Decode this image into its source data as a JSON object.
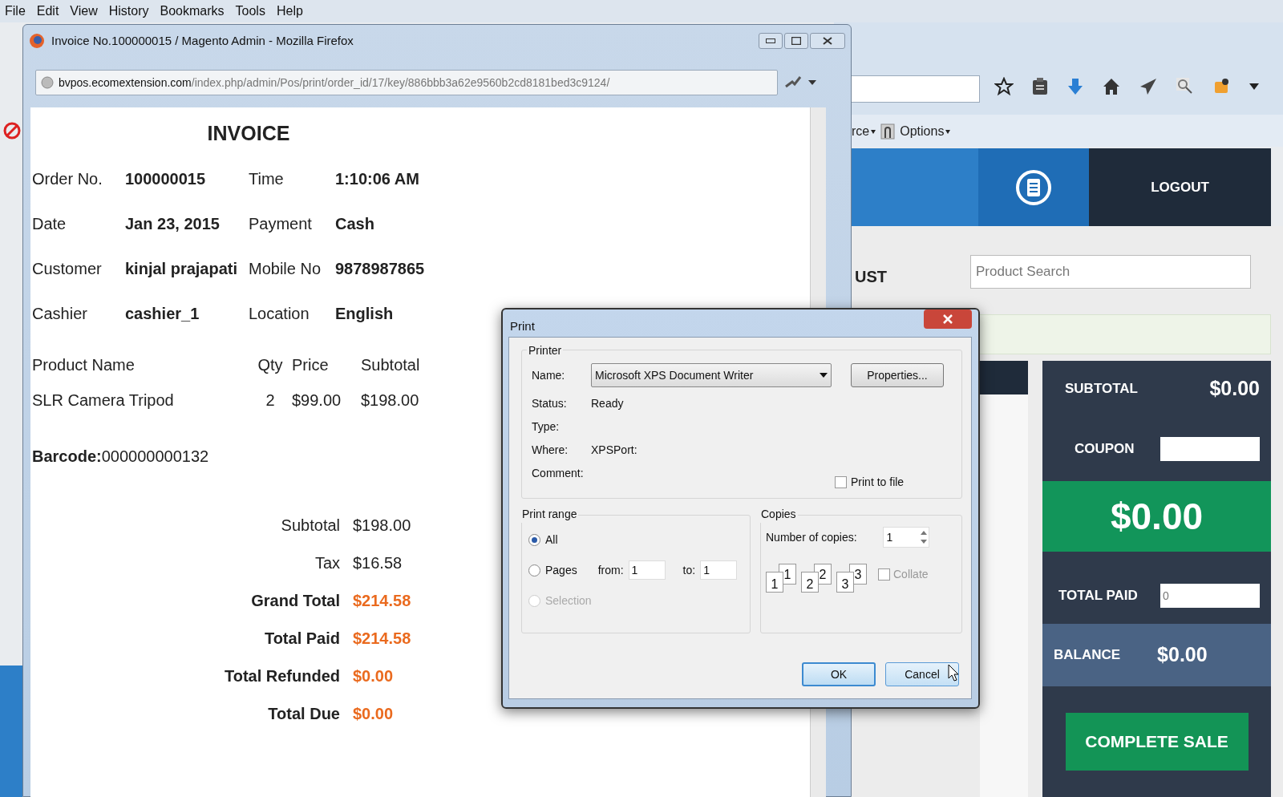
{
  "menu_bar": [
    {
      "label": "File"
    },
    {
      "label": "Edit"
    },
    {
      "label": "View"
    },
    {
      "label": "History"
    },
    {
      "label": "Bookmarks"
    },
    {
      "label": "Tools"
    },
    {
      "label": "Help"
    }
  ],
  "background_browser": {
    "bookmarks": [
      {
        "label": "rce"
      },
      {
        "label": "Options"
      }
    ]
  },
  "pos": {
    "logout": "LOGOUT",
    "list_heading": "UST",
    "search_placeholder": "Product Search",
    "summary": {
      "subtotal_label": "SUBTOTAL",
      "subtotal": "$0.00",
      "coupon_label": "COUPON",
      "total": "$0.00",
      "total_paid_label": "TOTAL PAID",
      "total_paid": "0",
      "balance_label": "BALANCE",
      "balance": "$0.00",
      "complete_button": "COMPLETE SALE"
    }
  },
  "popup": {
    "title": "Invoice No.100000015 / Magento Admin - Mozilla Firefox",
    "url_host": "bvpos.ecomextension.com",
    "url_path": "/index.php/admin/Pos/print/order_id/17/key/886bbb3a62e9560b2cd8181bed3c9124/",
    "invoice": {
      "heading": "INVOICE",
      "details": [
        {
          "label": "Order No.",
          "value": "100000015",
          "label2": "Time",
          "value2": "1:10:06 AM"
        },
        {
          "label": "Date",
          "value": "Jan 23, 2015",
          "label2": "Payment",
          "value2": "Cash"
        },
        {
          "label": "Customer",
          "value": "kinjal prajapati",
          "label2": "Mobile No",
          "value2": "9878987865"
        },
        {
          "label": "Cashier",
          "value": "cashier_1",
          "label2": "Location",
          "value2": "English"
        }
      ],
      "columns": [
        "Product Name",
        "Qty",
        "Price",
        "Subtotal"
      ],
      "rows": [
        [
          "SLR Camera Tripod",
          "2",
          "$99.00",
          "$198.00"
        ]
      ],
      "barcode": "**Barcode:**000000000132",
      "totals": [
        {
          "label": "Subtotal",
          "value": "$198.00",
          "emphasis": false
        },
        {
          "label": "Tax",
          "value": "$16.58",
          "emphasis": false
        },
        {
          "label": "Grand Total",
          "value": "$214.58",
          "emphasis": true
        },
        {
          "label": "Total Paid",
          "value": "$214.58",
          "emphasis": true
        },
        {
          "label": "Total Refunded",
          "value": "$0.00",
          "emphasis": true
        },
        {
          "label": "Total Due",
          "value": "$0.00",
          "emphasis": true
        }
      ]
    }
  },
  "print_dialog": {
    "title": "Print",
    "printer_group": "Printer",
    "name_label": "Name:",
    "printer_name": "Microsoft XPS Document Writer",
    "properties_button": "Properties...",
    "info": [
      {
        "label": "Status:",
        "value": "Ready"
      },
      {
        "label": "Type:"
      },
      {
        "label": "Where:",
        "value": "XPSPort:"
      },
      {
        "label": "Comment:"
      }
    ],
    "print_to_file": {
      "label": "Print to file",
      "checked": false
    },
    "range_group": "Print range",
    "range_options": [
      {
        "label": "All",
        "selected": true,
        "disabled": false
      },
      {
        "label": "Pages",
        "selected": false,
        "disabled": false
      },
      {
        "label": "Selection",
        "selected": false,
        "disabled": true
      }
    ],
    "from_label": "from:",
    "from": "1",
    "to_label": "to:",
    "to": "1",
    "copies_group": "Copies",
    "copies_label": "Number of copies:",
    "copies": "1",
    "collate_pages": [
      [
        "1",
        "1"
      ],
      [
        "2",
        "2"
      ],
      [
        "3",
        "3"
      ]
    ],
    "collate": {
      "label": "Collate",
      "checked": false,
      "disabled": true
    },
    "ok_button": "OK",
    "cancel_button": "Cancel"
  }
}
